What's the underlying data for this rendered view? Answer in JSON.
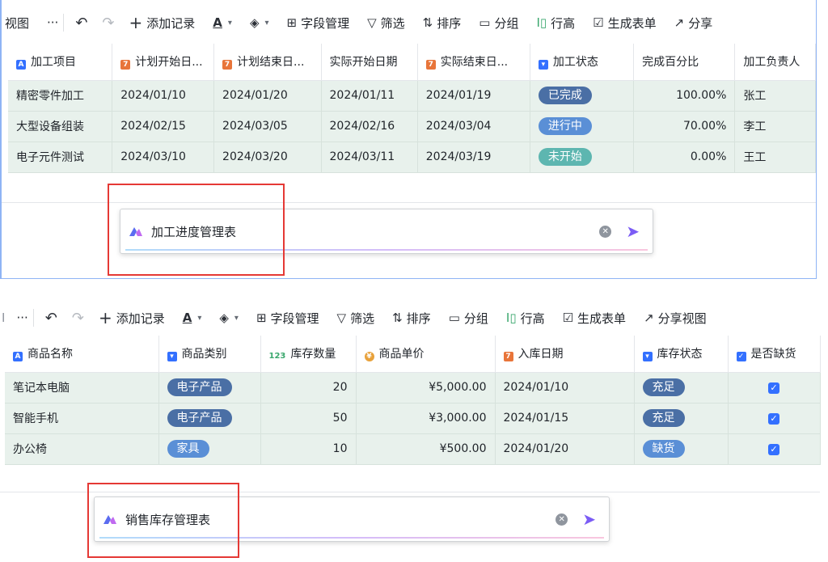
{
  "panel1": {
    "toolbar": {
      "view_label": "视图",
      "more": "···",
      "add_record": "添加记录",
      "field_manage": "字段管理",
      "filter": "筛选",
      "sort": "排序",
      "group": "分组",
      "row_height": "行高",
      "gen_form": "生成表单",
      "share": "分享"
    },
    "columns": [
      "加工项目",
      "计划开始日...",
      "计划结束日...",
      "实际开始日期",
      "实际结束日...",
      "加工状态",
      "完成百分比",
      "加工负责人"
    ],
    "rows": [
      {
        "item": "精密零件加工",
        "plan_start": "2024/01/10",
        "plan_end": "2024/01/20",
        "act_start": "2024/01/11",
        "act_end": "2024/01/19",
        "status": "已完成",
        "percent": "100.00%",
        "owner": "张工"
      },
      {
        "item": "大型设备组装",
        "plan_start": "2024/02/15",
        "plan_end": "2024/03/05",
        "act_start": "2024/02/16",
        "act_end": "2024/03/04",
        "status": "进行中",
        "percent": "70.00%",
        "owner": "李工"
      },
      {
        "item": "电子元件测试",
        "plan_start": "2024/03/10",
        "plan_end": "2024/03/20",
        "act_start": "2024/03/11",
        "act_end": "2024/03/19",
        "status": "未开始",
        "percent": "0.00%",
        "owner": "王工"
      }
    ],
    "ai_input": "加工进度管理表"
  },
  "panel2": {
    "toolbar": {
      "view_label": "I",
      "more": "···",
      "add_record": "添加记录",
      "field_manage": "字段管理",
      "filter": "筛选",
      "sort": "排序",
      "group": "分组",
      "row_height": "行高",
      "gen_form": "生成表单",
      "share": "分享视图"
    },
    "columns": [
      "商品名称",
      "商品类别",
      "库存数量",
      "商品单价",
      "入库日期",
      "库存状态",
      "是否缺货"
    ],
    "rows": [
      {
        "name": "笔记本电脑",
        "category": "电子产品",
        "qty": "20",
        "price": "¥5,000.00",
        "date": "2024/01/10",
        "status": "充足",
        "missing": true
      },
      {
        "name": "智能手机",
        "category": "电子产品",
        "qty": "50",
        "price": "¥3,000.00",
        "date": "2024/01/15",
        "status": "充足",
        "missing": true
      },
      {
        "name": "办公椅",
        "category": "家具",
        "qty": "10",
        "price": "¥500.00",
        "date": "2024/01/20",
        "status": "缺货",
        "missing": true
      }
    ],
    "ai_input": "销售库存管理表"
  },
  "icons": {
    "undo": "undo-icon",
    "redo": "redo-icon",
    "plus": "plus-icon",
    "text_color": "text-color-icon",
    "fill": "fill-color-icon",
    "grid": "field-grid-icon",
    "filter": "filter-icon",
    "sort": "sort-icon",
    "group": "folder-icon",
    "row_height": "row-height-icon",
    "form": "form-icon",
    "share": "share-icon",
    "send": "send-icon",
    "clear": "clear-icon"
  },
  "colors": {
    "accent": "#3370ff",
    "send": "#7b5cf5",
    "highlight": "#e53935",
    "row_bg": "#e8f1ec"
  }
}
